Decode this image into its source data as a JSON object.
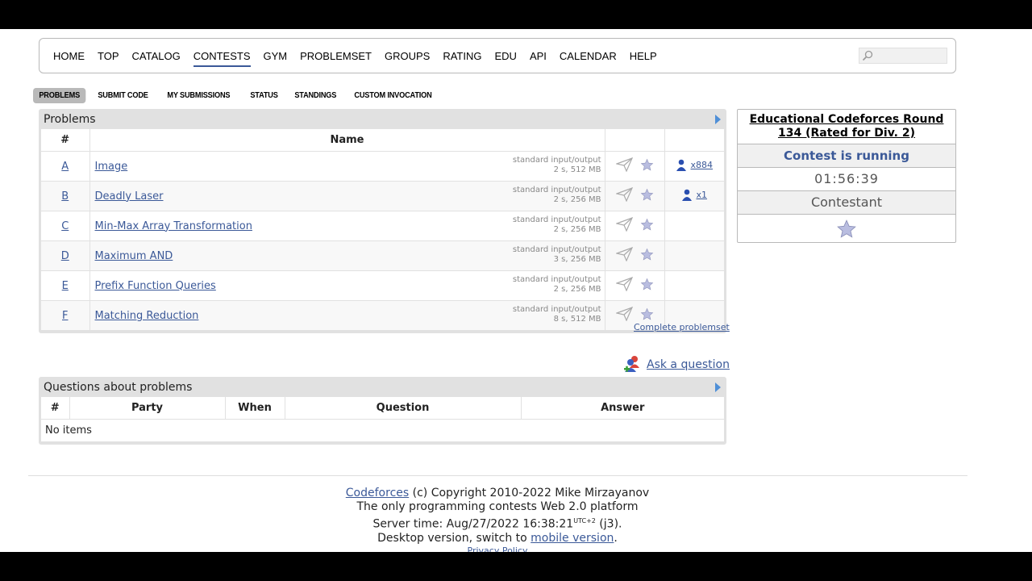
{
  "nav": {
    "items": [
      "HOME",
      "TOP",
      "CATALOG",
      "CONTESTS",
      "GYM",
      "PROBLEMSET",
      "GROUPS",
      "RATING",
      "EDU",
      "API",
      "CALENDAR",
      "HELP"
    ],
    "active": "CONTESTS",
    "search_placeholder": ""
  },
  "submenu": {
    "items": [
      "PROBLEMS",
      "SUBMIT CODE",
      "MY SUBMISSIONS",
      "STATUS",
      "STANDINGS",
      "CUSTOM INVOCATION"
    ],
    "active": "PROBLEMS"
  },
  "problems": {
    "caption": "Problems",
    "headers": {
      "index": "#",
      "name": "Name"
    },
    "rows": [
      {
        "index": "A",
        "name": "Image",
        "io": "standard input/output",
        "limits": "2 s, 512 MB",
        "solved": "x884"
      },
      {
        "index": "B",
        "name": "Deadly Laser",
        "io": "standard input/output",
        "limits": "2 s, 256 MB",
        "solved": "x1"
      },
      {
        "index": "C",
        "name": "Min-Max Array Transformation",
        "io": "standard input/output",
        "limits": "2 s, 256 MB",
        "solved": ""
      },
      {
        "index": "D",
        "name": "Maximum AND",
        "io": "standard input/output",
        "limits": "3 s, 256 MB",
        "solved": ""
      },
      {
        "index": "E",
        "name": "Prefix Function Queries",
        "io": "standard input/output",
        "limits": "2 s, 256 MB",
        "solved": ""
      },
      {
        "index": "F",
        "name": "Matching Reduction",
        "io": "standard input/output",
        "limits": "8 s, 512 MB",
        "solved": ""
      }
    ],
    "complete_link": "Complete problemset"
  },
  "ask": {
    "label": "Ask a question"
  },
  "questions": {
    "caption": "Questions about problems",
    "headers": {
      "index": "#",
      "party": "Party",
      "when": "When",
      "question": "Question",
      "answer": "Answer"
    },
    "empty": "No items"
  },
  "sidebar": {
    "contest_name": "Educational Codeforces Round 134 (Rated for Div. 2)",
    "status": "Contest is running",
    "timer": "01:56:39",
    "role": "Contestant"
  },
  "footer": {
    "brand": "Codeforces",
    "copyright": " (c) Copyright 2010-2022 Mike Mirzayanov",
    "tagline": "The only programming contests Web 2.0 platform",
    "server_time_label": "Server time: Aug/27/2022 16:38:21",
    "utc": "UTC+2",
    "server_suffix": " (j3).",
    "desktop_prefix": "Desktop version, switch to ",
    "mobile_link": "mobile version",
    "desktop_suffix": ".",
    "privacy": "Privacy Policy"
  },
  "colors": {
    "link": "#3b5998",
    "accent_arrow": "#4f8fd7",
    "header_bg": "#e1e1e1"
  }
}
